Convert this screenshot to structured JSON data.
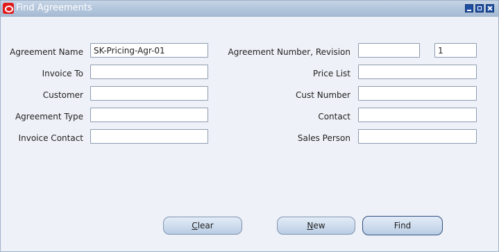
{
  "window": {
    "title": "Find Agreements"
  },
  "left_fields": [
    {
      "label": "Agreement Name",
      "value": "SK-Pricing-Agr-01",
      "placeholder": ""
    },
    {
      "label": "Invoice To",
      "value": "",
      "placeholder": ""
    },
    {
      "label": "Customer",
      "value": "",
      "placeholder": ""
    },
    {
      "label": "Agreement Type",
      "value": "",
      "placeholder": ""
    },
    {
      "label": "Invoice Contact",
      "value": "",
      "placeholder": ""
    }
  ],
  "right_fields": [
    {
      "label": "Agreement Number, Revision",
      "value": "",
      "revision": "1"
    },
    {
      "label": "Price List",
      "value": ""
    },
    {
      "label": "Cust Number",
      "value": ""
    },
    {
      "label": "Contact",
      "value": ""
    },
    {
      "label": "Sales Person",
      "value": ""
    }
  ],
  "buttons": {
    "clear": {
      "mnemonic": "C",
      "rest": "lear"
    },
    "new": {
      "mnemonic": "N",
      "rest": "ew"
    },
    "find": {
      "label": "Find"
    }
  },
  "colors": {
    "titlebar": "#b3c6dc",
    "background": "#eef1f7",
    "oracle_red": "#e31b1b"
  },
  "icons": [
    "oracle-logo-icon",
    "minimize-icon",
    "maximize-icon",
    "close-icon"
  ]
}
